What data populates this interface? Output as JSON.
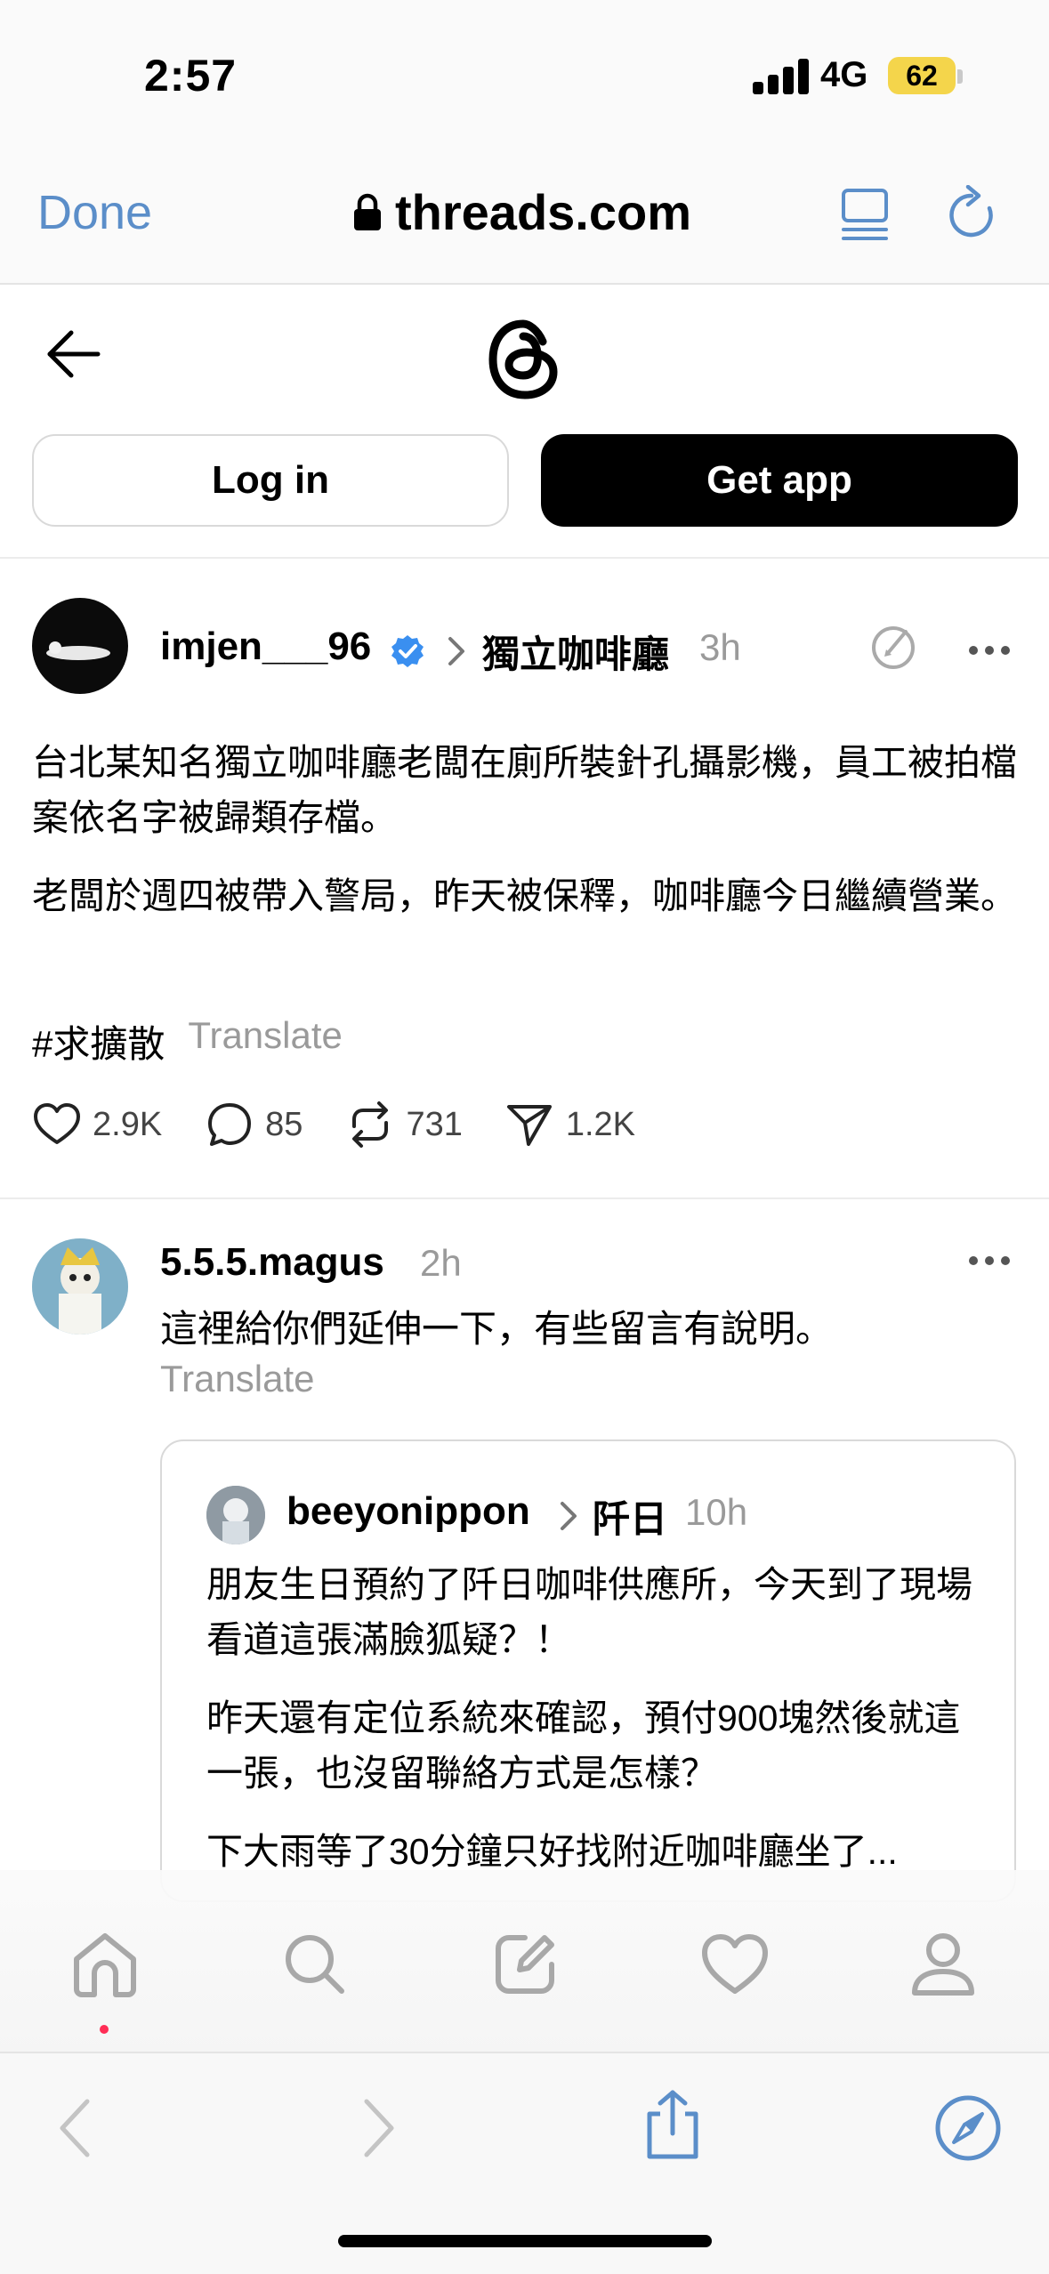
{
  "status_bar": {
    "time": "2:57",
    "network": "4G",
    "battery": "62"
  },
  "browser": {
    "done_label": "Done",
    "url": "threads.com"
  },
  "header": {
    "login_label": "Log in",
    "getapp_label": "Get app"
  },
  "post": {
    "username": "imjen___96",
    "tag": "獨立咖啡廳",
    "time": "3h",
    "body": [
      "台北某知名獨立咖啡廳老闆在廁所裝針孔攝影機，員工被拍檔案依名字被歸類存檔。",
      "老闆於週四被帶入警局，昨天被保釋，咖啡廳今日繼續營業。"
    ],
    "hashtag": "#求擴散",
    "translate": "Translate",
    "actions": {
      "likes": "2.9K",
      "comments": "85",
      "reposts": "731",
      "shares": "1.2K"
    }
  },
  "reply": {
    "username": "5.5.5.magus",
    "time": "2h",
    "text": "這裡給你們延伸一下，有些留言有說明。",
    "translate": "Translate",
    "quote": {
      "username": "beeyonippon",
      "tag": "阡日",
      "time": "10h",
      "body": [
        "朋友生日預約了阡日咖啡供應所，今天到了現場看道這張滿臉狐疑？！",
        "昨天還有定位系統來確認，預付900塊然後就這一張，也沒留聯絡方式是怎樣？",
        "下大雨等了30分鐘只好找附近咖啡廳坐了..."
      ]
    }
  },
  "colors": {
    "link_blue": "#5b8ec9",
    "verified_blue": "#3a8ff0",
    "muted": "#9a9a9a",
    "notification_dot": "#ff2d55"
  }
}
